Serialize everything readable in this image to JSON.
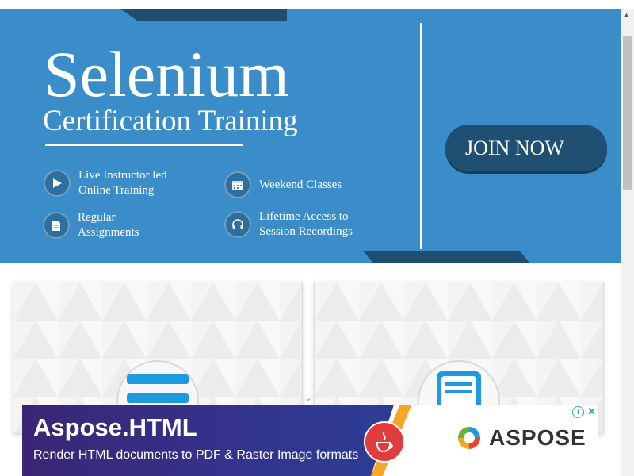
{
  "banner": {
    "title": "Selenium",
    "subtitle": "Certification Training",
    "features": [
      {
        "icon": "play-icon",
        "label": "Live Instructor led\nOnline Training"
      },
      {
        "icon": "calendar-icon",
        "label": "Weekend Classes"
      },
      {
        "icon": "document-icon",
        "label": "Regular\nAssignments"
      },
      {
        "icon": "headphones-icon",
        "label": "Lifetime Access to\nSession Recordings"
      }
    ],
    "cta_label": "JOIN NOW",
    "colors": {
      "background": "#3a8dc8",
      "accent": "#1f4f72"
    }
  },
  "cards": [
    {
      "icon": "menu-list-icon"
    },
    {
      "icon": "document-lines-icon"
    }
  ],
  "ad": {
    "title": "Aspose.HTML",
    "subtitle": "Render HTML documents to PDF & Raster Image formats",
    "brand": "ASPOSE",
    "info_icon": "info-icon",
    "close_icon": "close-icon"
  }
}
